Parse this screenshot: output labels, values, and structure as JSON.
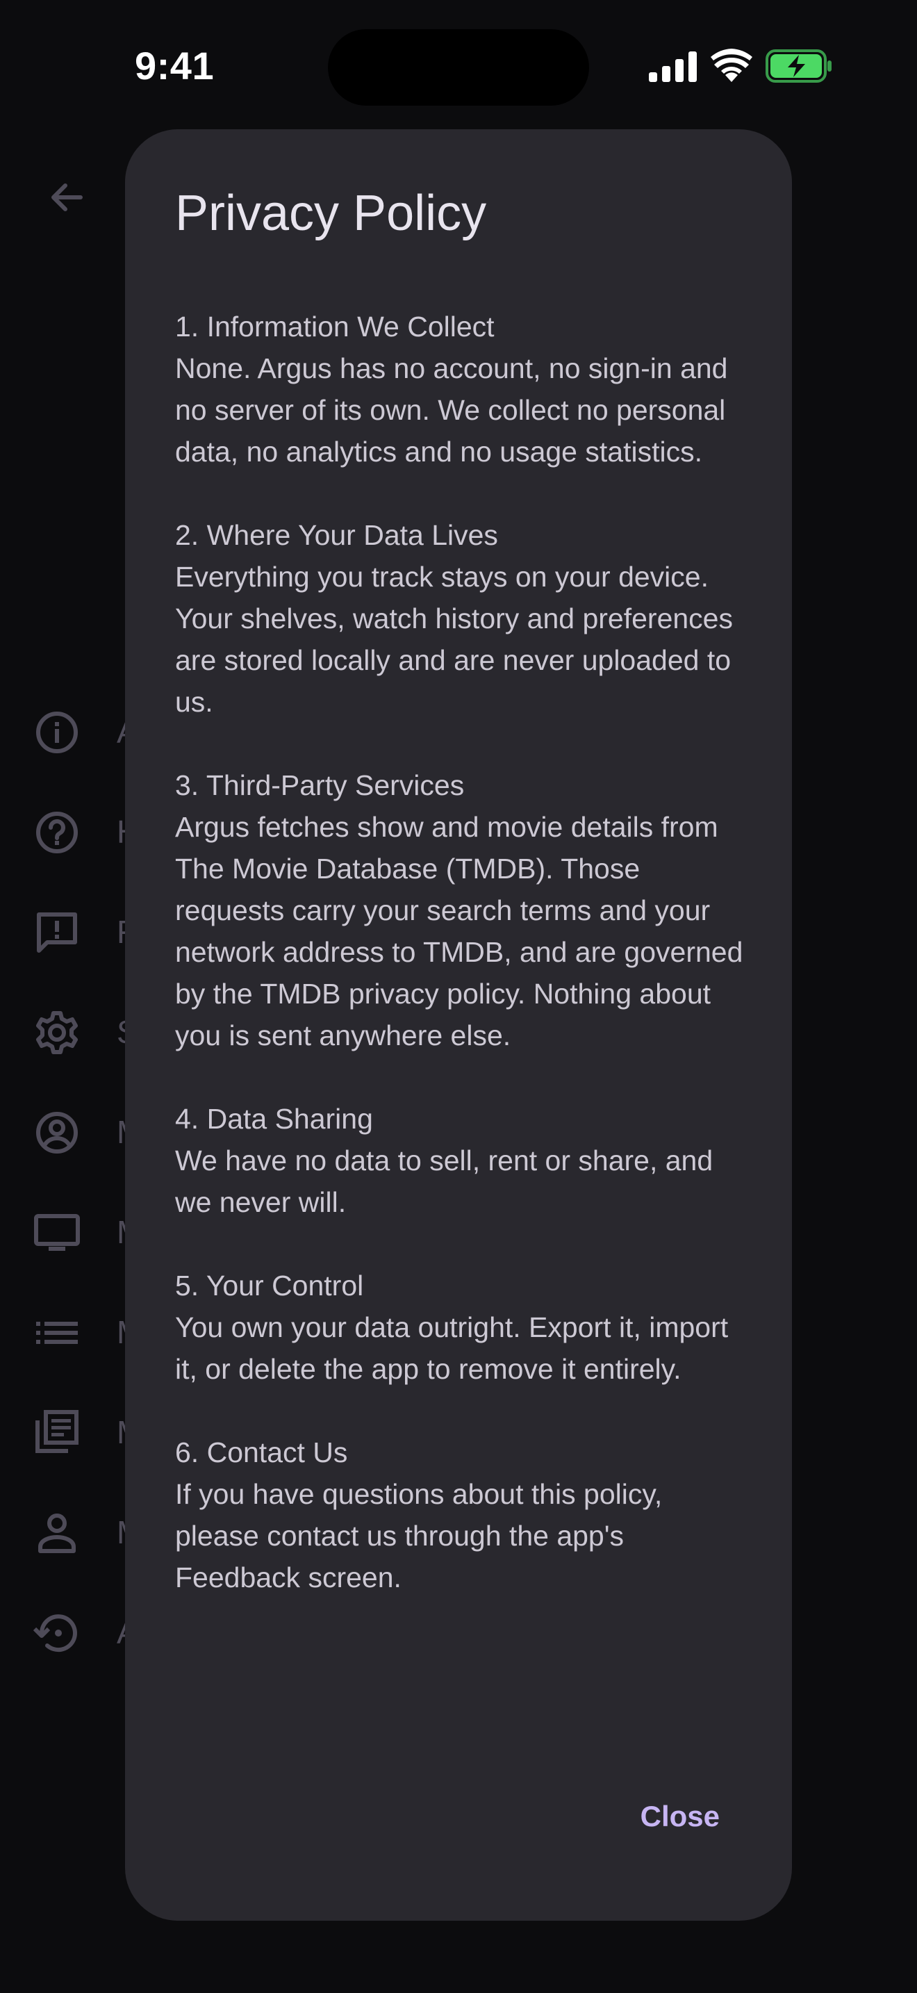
{
  "status_bar": {
    "time": "9:41"
  },
  "background_page": {
    "back_icon": "arrow-left-icon",
    "menu_items": [
      {
        "icon": "info-circle-icon",
        "label": "A"
      },
      {
        "icon": "help-circle-icon",
        "label": "H"
      },
      {
        "icon": "feedback-icon",
        "label": "F"
      },
      {
        "icon": "gear-icon",
        "label": "S"
      },
      {
        "icon": "account-circle-icon",
        "label": "M"
      },
      {
        "icon": "tv-icon",
        "label": "M"
      },
      {
        "icon": "list-icon",
        "label": "M"
      },
      {
        "icon": "library-books-icon",
        "label": "M"
      },
      {
        "icon": "person-icon",
        "label": "M"
      },
      {
        "icon": "history-icon",
        "label": "A"
      }
    ]
  },
  "dialog": {
    "title": "Privacy Policy",
    "sections": [
      {
        "heading": "1. Information We Collect",
        "text": "None. Argus has no account, no sign-in and no server of its own. We collect no personal data, no analytics and no usage statistics."
      },
      {
        "heading": "2. Where Your Data Lives",
        "text": "Everything you track stays on your device. Your shelves, watch history and preferences are stored locally and are never uploaded to us."
      },
      {
        "heading": "3. Third-Party Services",
        "text": "Argus fetches show and movie details from The Movie Database (TMDB). Those requests carry your search terms and your network address to TMDB, and are governed by the TMDB privacy policy. Nothing about you is sent anywhere else."
      },
      {
        "heading": "4. Data Sharing",
        "text": "We have no data to sell, rent or share, and we never will."
      },
      {
        "heading": "5. Your Control",
        "text": "You own your data outright. Export it, import it, or delete the app to remove it entirely."
      },
      {
        "heading": "6. Contact Us",
        "text": "If you have questions about this policy, please contact us through the app's Feedback screen."
      }
    ],
    "close_label": "Close"
  },
  "colors": {
    "background": "#0c0c0e",
    "dialog": "#29282e",
    "accent": "#c7b5f3",
    "battery": "#4cd964"
  }
}
